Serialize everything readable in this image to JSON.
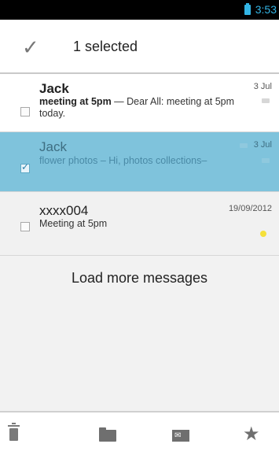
{
  "status_bar": {
    "time": "3:53"
  },
  "action_bar": {
    "selection_count_text": "1 selected",
    "done_icon": "checkmark-icon"
  },
  "messages": [
    {
      "sender": "Jack",
      "date": "3 Jul",
      "subject": "meeting at 5pm",
      "separator": " — ",
      "snippet": "Dear All: meeting at 5pm today.",
      "state": "unread",
      "selected": false
    },
    {
      "sender": "Jack",
      "date": "3 Jul",
      "subject": "flower photos",
      "separator": " – ",
      "snippet": "Hi, photos collections–",
      "state": "read",
      "selected": true
    },
    {
      "sender": "xxxx004",
      "date": "19/09/2012",
      "subject": "",
      "separator": "",
      "snippet": "Meeting at 5pm",
      "state": "read",
      "selected": false,
      "starred": true
    }
  ],
  "load_more_label": "Load more messages",
  "bottom_actions": [
    {
      "icon": "trash-icon",
      "label": "Delete"
    },
    {
      "icon": "folder-icon",
      "label": "Move"
    },
    {
      "icon": "mail-icon",
      "label": "Mark unread"
    },
    {
      "icon": "star-icon",
      "label": "Star"
    }
  ],
  "colors": {
    "accent": "#33b5e5",
    "selected_row": "#7fc3dc"
  }
}
